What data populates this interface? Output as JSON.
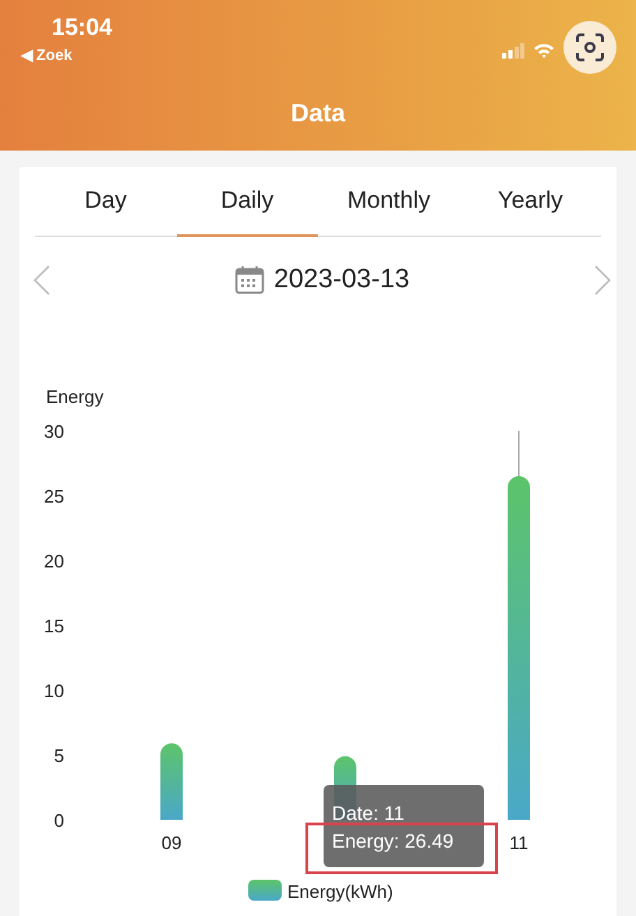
{
  "status_bar": {
    "time": "15:04",
    "back_label": "◀ Zoek"
  },
  "header": {
    "title": "Data"
  },
  "tabs": [
    {
      "label": "Day",
      "selected": false
    },
    {
      "label": "Daily",
      "selected": true
    },
    {
      "label": "Monthly",
      "selected": false
    },
    {
      "label": "Yearly",
      "selected": false
    }
  ],
  "date": "2023-03-13",
  "chart": {
    "chart_data": {
      "type": "bar",
      "ylabel": "Energy",
      "x": [
        9,
        10,
        11
      ],
      "xlim": [
        9,
        11
      ],
      "xticks": [
        {
          "value": 9,
          "label": "09"
        },
        {
          "value": 11,
          "label": "11"
        }
      ],
      "series": [
        {
          "name": "Energy(kWh)",
          "color": "#5cc46a",
          "values": [
            5.9,
            4.9,
            26.5
          ]
        }
      ],
      "ylim": [
        0,
        30
      ],
      "yticks": [
        0,
        5,
        10,
        15,
        20,
        25,
        30
      ]
    },
    "bar_selected": [
      false,
      false,
      true
    ],
    "tooltip": {
      "lines": [
        "Date: 11",
        "Energy: 26.49"
      ],
      "highlighted": true
    }
  }
}
